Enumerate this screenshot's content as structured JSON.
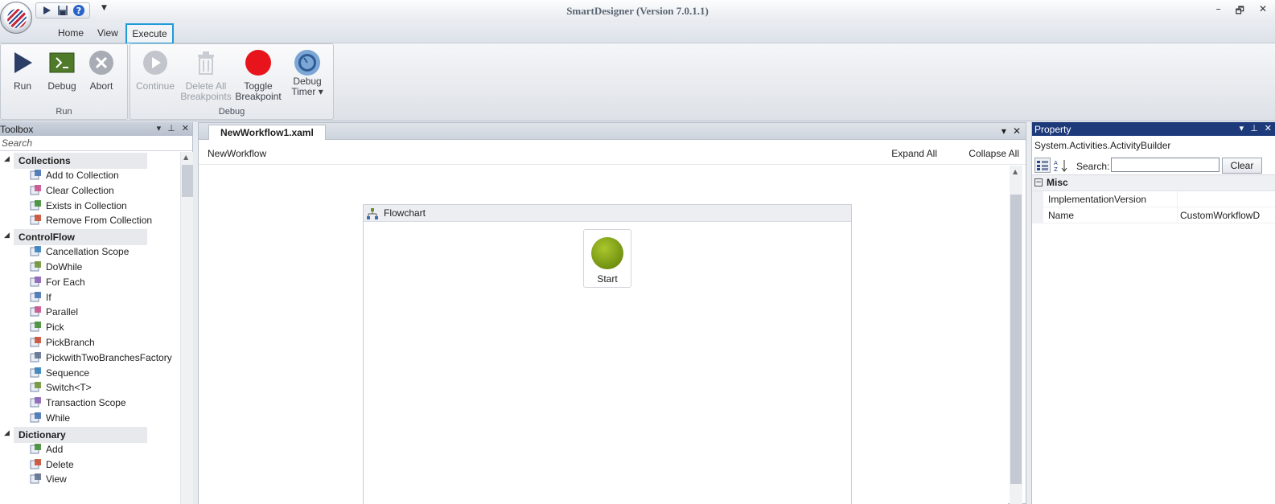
{
  "app": {
    "title": "SmartDesigner (Version 7.0.1.1)"
  },
  "window_controls": {
    "minimize": "–",
    "restore": "🗗",
    "close": "✕"
  },
  "quick_access": {
    "more": "▼"
  },
  "ribbon_tabs": [
    {
      "label": "Home"
    },
    {
      "label": "View"
    },
    {
      "label": "Execute"
    }
  ],
  "ribbon": {
    "run_group": {
      "label": "Run",
      "buttons": [
        {
          "label": "Run"
        },
        {
          "label": "Debug"
        },
        {
          "label": "Abort"
        }
      ]
    },
    "debug_group": {
      "label": "Debug",
      "buttons": [
        {
          "label1": "Continue",
          "label2": ""
        },
        {
          "label1": "Delete All",
          "label2": "Breakpoints"
        },
        {
          "label1": "Toggle",
          "label2": "Breakpoint"
        },
        {
          "label1": "Debug",
          "label2": "Timer ▾"
        }
      ]
    }
  },
  "toolbox": {
    "title": "Toolbox",
    "search_placeholder": "Search",
    "categories": [
      {
        "label": "Collections",
        "items": [
          "Add to Collection",
          "Clear Collection",
          "Exists in Collection",
          "Remove From Collection"
        ]
      },
      {
        "label": "ControlFlow",
        "items": [
          "Cancellation Scope",
          "DoWhile",
          "For Each",
          "If",
          "Parallel",
          "Pick",
          "PickBranch",
          "PickwithTwoBranchesFactory",
          "Sequence",
          "Switch<T>",
          "Transaction Scope",
          "While"
        ]
      },
      {
        "label": "Dictionary",
        "items": [
          "Add",
          "Delete",
          "View"
        ]
      }
    ]
  },
  "designer": {
    "tab_label": "NewWorkflow1.xaml",
    "breadcrumb": "NewWorkflow",
    "expand_all": "Expand All",
    "collapse_all": "Collapse All",
    "flowchart_title": "Flowchart",
    "start_label": "Start"
  },
  "property": {
    "title": "Property",
    "object_type": "System.Activities.ActivityBuilder",
    "search_label": "Search:",
    "search_value": "",
    "clear_label": "Clear",
    "category": "Misc",
    "rows": [
      {
        "name": "ImplementationVersion",
        "value": ""
      },
      {
        "name": "Name",
        "value": "CustomWorkflowD"
      }
    ]
  },
  "colors": {
    "highlight_border": "#1d9bd8",
    "property_header": "#1d3a7a",
    "breakpoint_red": "#e8141c",
    "start_green": "#86a81c"
  }
}
